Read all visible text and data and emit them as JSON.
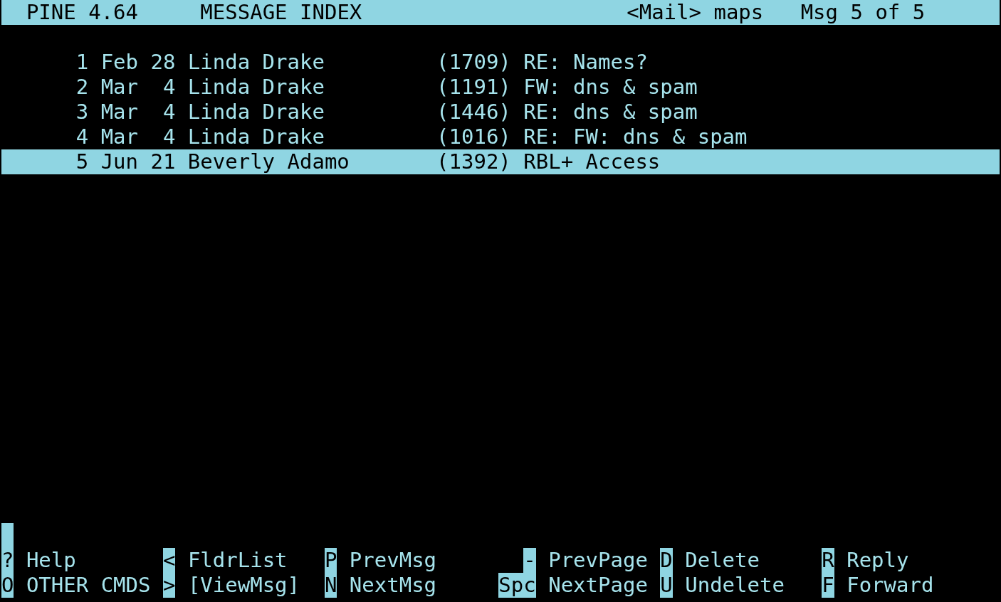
{
  "title_bar": {
    "program": "PINE 4.64",
    "screen": "MESSAGE INDEX",
    "folder": "<Mail> maps",
    "position": "Msg 5 of 5"
  },
  "messages": [
    {
      "number": "1",
      "date": "Feb 28",
      "from": "Linda Drake",
      "size": "(1709)",
      "subject": "RE: Names?",
      "selected": false
    },
    {
      "number": "2",
      "date": "Mar  4",
      "from": "Linda Drake",
      "size": "(1191)",
      "subject": "FW: dns & spam",
      "selected": false
    },
    {
      "number": "3",
      "date": "Mar  4",
      "from": "Linda Drake",
      "size": "(1446)",
      "subject": "RE: dns & spam",
      "selected": false
    },
    {
      "number": "4",
      "date": "Mar  4",
      "from": "Linda Drake",
      "size": "(1016)",
      "subject": "RE: FW: dns & spam",
      "selected": false
    },
    {
      "number": "5",
      "date": "Jun 21",
      "from": "Beverly Adamo",
      "size": "(1392)",
      "subject": "RBL+ Access",
      "selected": true
    }
  ],
  "command_menu": [
    [
      {
        "key": "?",
        "label": "Help"
      },
      {
        "key": "<",
        "label": "FldrList"
      },
      {
        "key": "P",
        "label": "PrevMsg"
      },
      {
        "key": "-",
        "label": "PrevPage"
      },
      {
        "key": "D",
        "label": "Delete"
      },
      {
        "key": "R",
        "label": "Reply"
      }
    ],
    [
      {
        "key": "O",
        "label": "OTHER CMDS"
      },
      {
        "key": ">",
        "label": "[ViewMsg]"
      },
      {
        "key": "N",
        "label": "NextMsg"
      },
      {
        "key": "Spc",
        "label": "NextPage"
      },
      {
        "key": "U",
        "label": "Undelete"
      },
      {
        "key": "F",
        "label": "Forward"
      }
    ]
  ]
}
